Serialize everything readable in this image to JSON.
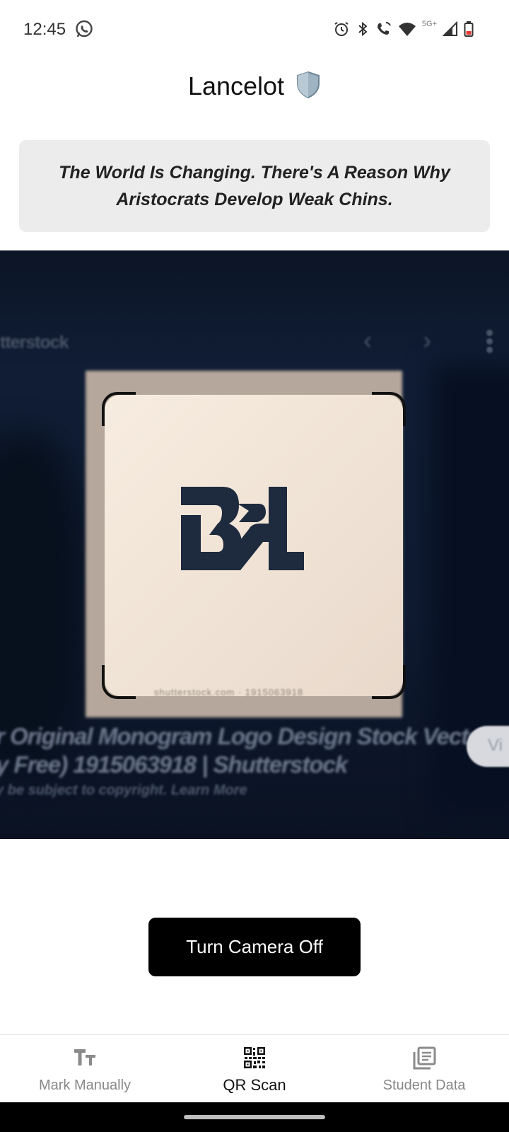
{
  "status_bar": {
    "time": "12:45",
    "network_badge": "5G+",
    "icons": [
      "whatsapp-icon",
      "alarm-icon",
      "bluetooth-icon",
      "wifi-calling-icon",
      "wifi-icon",
      "signal-icon",
      "battery-low-icon"
    ]
  },
  "app": {
    "title": "Lancelot",
    "title_icon": "shield-icon"
  },
  "quote": {
    "text": "The World Is Changing. There's A Reason Why Aristocrats Develop Weak Chins."
  },
  "camera": {
    "top_text": "tterstock",
    "caption_line1": "r Original Monogram Logo Design Stock Vector",
    "caption_line2": "y Free) 1915063918 | Shutterstock",
    "caption_line3": "y be subject to copyright. Learn More",
    "pill_text": "Vi",
    "scan_footer": "shutterstock.com · 1915063918",
    "logo_text": "BRL"
  },
  "actions": {
    "camera_toggle_label": "Turn Camera Off"
  },
  "bottom_nav": {
    "items": [
      {
        "label": "Mark Manually",
        "icon": "text-size-icon",
        "active": false
      },
      {
        "label": "QR Scan",
        "icon": "qr-code-icon",
        "active": true
      },
      {
        "label": "Student Data",
        "icon": "library-books-icon",
        "active": false
      }
    ]
  },
  "colors": {
    "accent": "#000000",
    "quote_bg": "#ececec",
    "inactive_nav": "#888888"
  }
}
